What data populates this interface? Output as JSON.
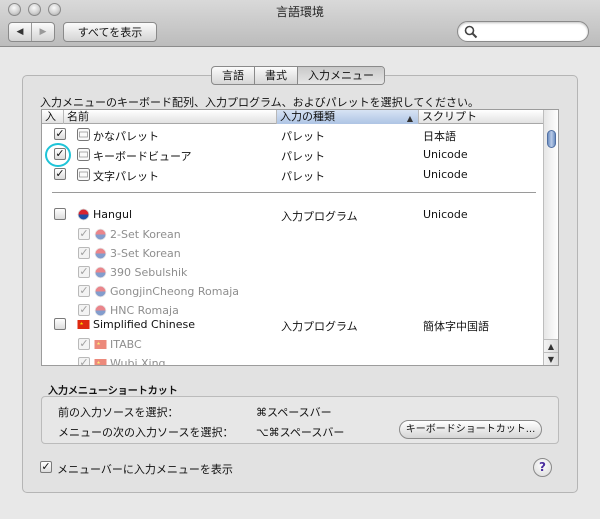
{
  "window": {
    "title": "言語環境"
  },
  "toolbar": {
    "back_label": "◀",
    "forward_label": "▶",
    "show_all_label": "すべてを表示",
    "search_placeholder": ""
  },
  "tabs": [
    {
      "label": "言語",
      "active": false
    },
    {
      "label": "書式",
      "active": false
    },
    {
      "label": "入力メニュー",
      "active": true
    }
  ],
  "instruction": "入力メニューのキーボード配列、入力プログラム、およびパレットを選択してください。",
  "table": {
    "columns": [
      "入",
      "名前",
      "入力の種類",
      "スクリプト"
    ],
    "sort_indicator": "▲",
    "rows": [
      {
        "checked": true,
        "dim": false,
        "name": "かなパレット",
        "type": "パレット",
        "script": "日本語",
        "icon": "kana-palette-icon"
      },
      {
        "checked": true,
        "dim": false,
        "name": "キーボードビューア",
        "type": "パレット",
        "script": "Unicode",
        "icon": "keyboard-viewer-icon"
      },
      {
        "checked": true,
        "dim": false,
        "name": "文字パレット",
        "type": "パレット",
        "script": "Unicode",
        "icon": "character-palette-icon"
      },
      {
        "checked": false,
        "dim": false,
        "name": "Hangul",
        "type": "入力プログラム",
        "script": "Unicode",
        "icon": "korea-flag-icon"
      },
      {
        "checked": true,
        "dim": true,
        "name": "2-Set Korean",
        "type": "",
        "script": "",
        "icon": "korea-flag-icon"
      },
      {
        "checked": true,
        "dim": true,
        "name": "3-Set Korean",
        "type": "",
        "script": "",
        "icon": "korea-flag-icon"
      },
      {
        "checked": true,
        "dim": true,
        "name": "390 Sebulshik",
        "type": "",
        "script": "",
        "icon": "korea-flag-icon"
      },
      {
        "checked": true,
        "dim": true,
        "name": "GongjinCheong Romaja",
        "type": "",
        "script": "",
        "icon": "korea-flag-icon"
      },
      {
        "checked": true,
        "dim": true,
        "name": "HNC Romaja",
        "type": "",
        "script": "",
        "icon": "korea-flag-icon"
      },
      {
        "checked": false,
        "dim": false,
        "name": "Simplified Chinese",
        "type": "入力プログラム",
        "script": "簡体字中国語",
        "icon": "china-flag-icon"
      },
      {
        "checked": true,
        "dim": true,
        "name": "ITABC",
        "type": "",
        "script": "",
        "icon": "china-flag-icon"
      },
      {
        "checked": true,
        "dim": true,
        "name": "Wubi Xing",
        "type": "",
        "script": "",
        "icon": "china-flag-icon"
      }
    ]
  },
  "shortcuts": {
    "title": "入力メニューショートカット",
    "prev_label": "前の入力ソースを選択：",
    "prev_key": "⌘スペースバー",
    "next_label": "メニューの次の入力ソースを選択：",
    "next_key": "⌥⌘スペースバー",
    "keyboard_shortcuts_button": "キーボードショートカット..."
  },
  "show_in_menubar": {
    "checked": true,
    "label": "メニューバーに入力メニューを表示"
  },
  "help_label": "?",
  "colors": {
    "highlight_circle": "#1ec4d8",
    "scroll_thumb": "#6e8fc2"
  }
}
